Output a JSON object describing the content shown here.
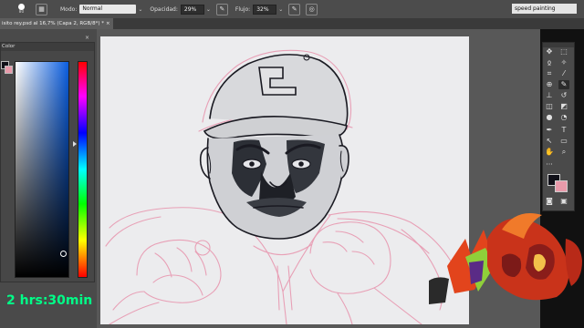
{
  "options_bar": {
    "brush_size": "80",
    "mode_label": "Modo:",
    "mode_value": "Normal",
    "opacity_label": "Opacidad:",
    "opacity_value": "29%",
    "flow_label": "Flujo:",
    "flow_value": "32%"
  },
  "workspace": {
    "selected": "speed painting"
  },
  "document_tab": {
    "title": "isito rey.psd al 16,7% (Capa 2, RGB/8*) *",
    "close": "×"
  },
  "color_panel": {
    "title": "Color",
    "close": "×"
  },
  "overlay": {
    "timer_text": "2 hrs:30min"
  },
  "icons": [
    "brush-icon",
    "brush-preset-icon",
    "pressure-opacity-icon",
    "pressure-size-icon",
    "move-icon",
    "marquee-icon",
    "lasso-icon",
    "magic-wand-icon",
    "crop-icon",
    "eyedropper-icon",
    "healing-icon",
    "brush-tool-icon",
    "stamp-icon",
    "history-brush-icon",
    "eraser-icon",
    "bucket-icon",
    "blur-icon",
    "dodge-icon",
    "pen-icon",
    "type-icon",
    "path-select-icon",
    "rectangle-icon",
    "hand-icon",
    "zoom-icon",
    "more-icon",
    "quickmask-icon",
    "screenmode-icon"
  ],
  "colors": {
    "foreground": "#101018",
    "background": "#e89aaa",
    "timer_green": "#00ff88",
    "canvas": "#ececee",
    "sketch_pink": "#e8a0b6"
  }
}
